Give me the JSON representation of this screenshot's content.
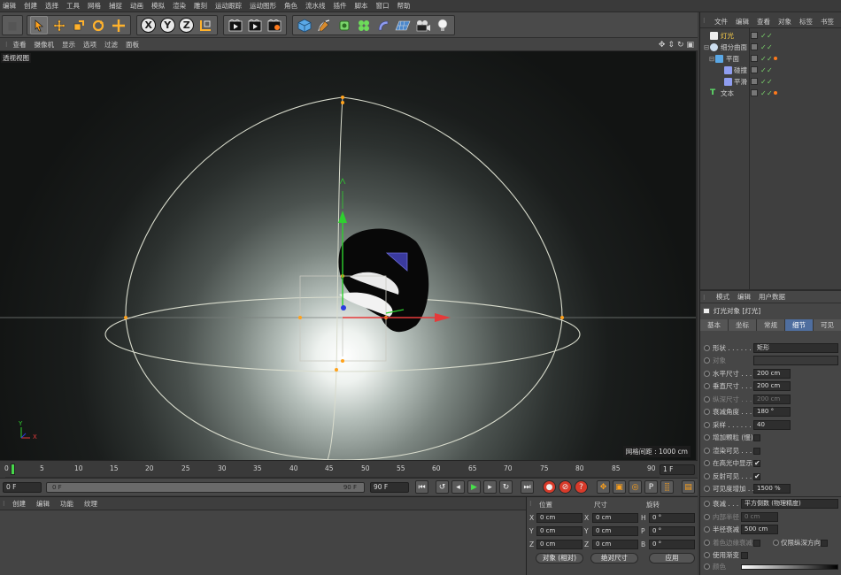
{
  "menubar": [
    "编辑",
    "创建",
    "选择",
    "工具",
    "网格",
    "捕捉",
    "动画",
    "模拟",
    "渲染",
    "雕刻",
    "运动跟踪",
    "运动图形",
    "角色",
    "流水线",
    "插件",
    "脚本",
    "窗口",
    "帮助"
  ],
  "viewport_menu": [
    "查看",
    "摄像机",
    "显示",
    "选项",
    "过滤",
    "面板"
  ],
  "viewport": {
    "label": "透视视图",
    "grid_label": "网格间距 : 1000 cm",
    "axis_y": "Y",
    "axis_x": "X"
  },
  "timeline": {
    "ticks": [
      "0",
      "5",
      "10",
      "15",
      "20",
      "25",
      "30",
      "35",
      "40",
      "45",
      "50",
      "55",
      "60",
      "65",
      "70",
      "75",
      "80",
      "85",
      "90"
    ],
    "end_field": "1 F"
  },
  "transport": {
    "start_frame": "0 F",
    "range_start": "0 F",
    "range_end": "90 F",
    "end_frame": "90 F"
  },
  "material_tabs": [
    "创建",
    "编辑",
    "功能",
    "纹理"
  ],
  "coordinates": {
    "headers": [
      "位置",
      "尺寸",
      "旋转"
    ],
    "rows": [
      {
        "axis": "X",
        "pos": "0 cm",
        "size_axis": "X",
        "size": "0 cm",
        "rot_axis": "H",
        "rot": "0 °"
      },
      {
        "axis": "Y",
        "pos": "0 cm",
        "size_axis": "Y",
        "size": "0 cm",
        "rot_axis": "P",
        "rot": "0 °"
      },
      {
        "axis": "Z",
        "pos": "0 cm",
        "size_axis": "Z",
        "size": "0 cm",
        "rot_axis": "B",
        "rot": "0 °"
      }
    ],
    "mode_select": "对象 (相对)",
    "size_select": "绝对尺寸",
    "apply_label": "应用"
  },
  "object_manager": {
    "tabs": [
      "文件",
      "编辑",
      "查看",
      "对象",
      "标签",
      "书签"
    ],
    "items": [
      {
        "name": "灯光",
        "color": "#ffd24a"
      },
      {
        "name": "细分曲面",
        "color": "#d0d0d0"
      },
      {
        "name": "平面",
        "color": "#d0d0d0"
      },
      {
        "name": "碰撞",
        "color": "#d0d0d0"
      },
      {
        "name": "平滑",
        "color": "#d0d0d0"
      },
      {
        "name": "文本",
        "color": "#d0d0d0"
      }
    ]
  },
  "attributes": {
    "top_tabs": [
      "模式",
      "编辑",
      "用户数据"
    ],
    "title": "灯光对象 [灯光]",
    "tabs": [
      "基本",
      "坐标",
      "常规",
      "细节",
      "可见"
    ],
    "rows": [
      {
        "label": "形状 . . . . . . . .",
        "value": "矩形"
      },
      {
        "label": "对象",
        "value": ""
      },
      {
        "label": "水平尺寸 . . . .",
        "value": "200 cm"
      },
      {
        "label": "垂直尺寸 . . . .",
        "value": "200 cm"
      },
      {
        "label": "纵深尺寸 . . . .",
        "value": "200 cm"
      },
      {
        "label": "衰减角度 . . . .",
        "value": "180 °"
      },
      {
        "label": "采样 . . . . . . . .",
        "value": "40"
      },
      {
        "label": "增加颗粒 (慢)",
        "value": ""
      },
      {
        "label": "渲染可见 . . . .",
        "value": ""
      },
      {
        "label": "在高光中显示",
        "value": "✔"
      },
      {
        "label": "反射可见 . . . .",
        "value": "✔"
      },
      {
        "label": "可见度增加 . .",
        "value": "1500 %"
      },
      {
        "label": "衰减 . . . . . . . .",
        "value": "平方倒数 (物理精度)"
      },
      {
        "label": "内部半径",
        "value": "0 cm"
      },
      {
        "label": "半径衰减 . . . .",
        "value": "500 cm"
      },
      {
        "label": "着色边缘衰减",
        "value": ""
      },
      {
        "label": "使用渐变",
        "value": ""
      },
      {
        "label": "颜色",
        "value": ""
      }
    ],
    "z_only_label": "仅限纵深方向"
  }
}
